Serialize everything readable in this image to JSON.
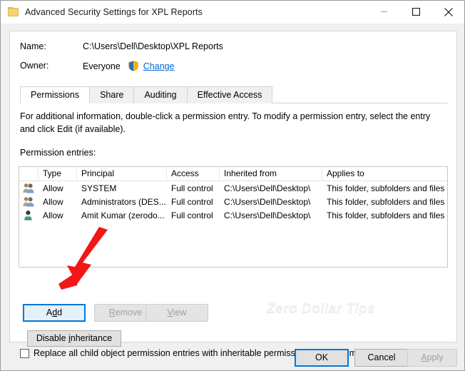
{
  "window": {
    "title": "Advanced Security Settings for XPL Reports",
    "icon": "folder-icon",
    "minimize_label": "Minimize",
    "maximize_label": "Maximize",
    "close_label": "Close"
  },
  "fields": {
    "name_label": "Name:",
    "name_value": "C:\\Users\\Dell\\Desktop\\XPL Reports",
    "owner_label": "Owner:",
    "owner_value": "Everyone",
    "owner_change_link": "Change"
  },
  "tabs": [
    {
      "label": "Permissions",
      "active": true
    },
    {
      "label": "Share",
      "active": false
    },
    {
      "label": "Auditing",
      "active": false
    },
    {
      "label": "Effective Access",
      "active": false
    }
  ],
  "info": {
    "text": "For additional information, double-click a permission entry. To modify a permission entry, select the entry and click Edit (if available).",
    "entries_label": "Permission entries:"
  },
  "table": {
    "columns": [
      "Type",
      "Principal",
      "Access",
      "Inherited from",
      "Applies to"
    ],
    "rows": [
      {
        "icon": "group-icon",
        "type": "Allow",
        "principal": "SYSTEM",
        "access": "Full control",
        "inherited_from": "C:\\Users\\Dell\\Desktop\\",
        "applies_to": "This folder, subfolders and files"
      },
      {
        "icon": "group-icon",
        "type": "Allow",
        "principal": "Administrators (DES....",
        "access": "Full control",
        "inherited_from": "C:\\Users\\Dell\\Desktop\\",
        "applies_to": "This folder, subfolders and files"
      },
      {
        "icon": "user-icon",
        "type": "Allow",
        "principal": "Amit Kumar (zerodo...",
        "access": "Full control",
        "inherited_from": "C:\\Users\\Dell\\Desktop\\",
        "applies_to": "This folder, subfolders and files"
      }
    ]
  },
  "buttons": {
    "add": "Add",
    "remove": "Remove",
    "view": "View",
    "disable_inheritance": "Disable inheritance",
    "ok": "OK",
    "cancel": "Cancel",
    "apply": "Apply"
  },
  "checkbox": {
    "label": "Replace all child object permission entries with inheritable permission entries from this object",
    "checked": false
  },
  "watermark": "Zero Dollar Tips",
  "annotation": {
    "type": "arrow",
    "color": "#f21616",
    "points_to": "Add"
  },
  "colors": {
    "accent": "#0078d7",
    "link": "#0066cc",
    "window_bg": "#f0f0f0",
    "panel_bg": "#ffffff"
  }
}
